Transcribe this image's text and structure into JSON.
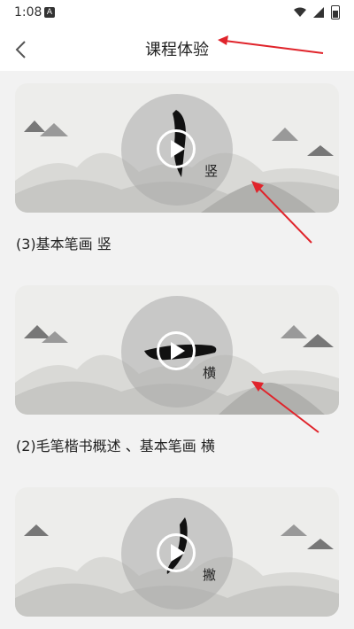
{
  "statusbar": {
    "time": "1:08",
    "notif_glyph": "A"
  },
  "header": {
    "title": "课程体验"
  },
  "lessons": [
    {
      "title": "(3)基本笔画 竖",
      "stroke": "竖"
    },
    {
      "title": "(2)毛笔楷书概述 、基本笔画 横",
      "stroke": "横"
    },
    {
      "title": "",
      "stroke": "撇"
    }
  ],
  "colors": {
    "arrow": "#e0242b",
    "background": "#f2f2f2"
  }
}
